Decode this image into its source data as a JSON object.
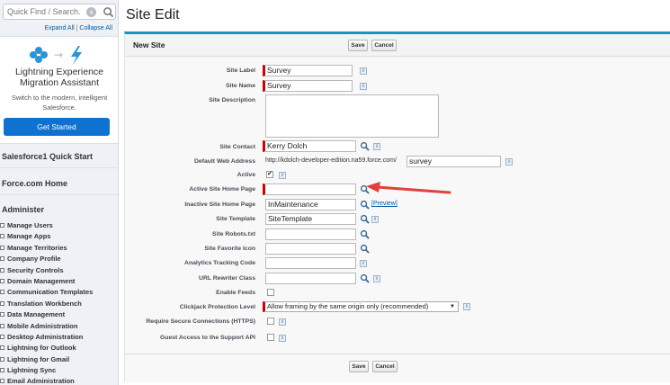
{
  "sidebar": {
    "search": {
      "placeholder": "Quick Find / Search...",
      "clear_label": "x"
    },
    "expand_all": "Expand All",
    "separator": "|",
    "collapse_all": "Collapse All",
    "lightning": {
      "title_line1": "Lightning Experience",
      "title_line2": "Migration Assistant",
      "desc_line1": "Switch to the modern, intelligent",
      "desc_line2": "Salesforce.",
      "button": "Get Started"
    },
    "sections": [
      "Salesforce1 Quick Start",
      "Force.com Home",
      "Administer"
    ],
    "admin_items": [
      "Manage Users",
      "Manage Apps",
      "Manage Territories",
      "Company Profile",
      "Security Controls",
      "Domain Management",
      "Communication Templates",
      "Translation Workbench",
      "Data Management",
      "Mobile Administration",
      "Desktop Administration",
      "Lightning for Outlook",
      "Lightning for Gmail",
      "Lightning Sync",
      "Email Administration"
    ]
  },
  "main": {
    "page_title": "Site Edit",
    "panel_title": "New Site",
    "save": "Save",
    "cancel": "Cancel",
    "info_glyph": "i",
    "fields": {
      "site_label": {
        "label": "Site Label",
        "value": "Survey"
      },
      "site_name": {
        "label": "Site Name",
        "value": "Survey"
      },
      "site_description": {
        "label": "Site Description",
        "value": ""
      },
      "site_contact": {
        "label": "Site Contact",
        "value": "Kerry Dolch"
      },
      "default_web_address": {
        "label": "Default Web Address",
        "prefix": "http://kdolch-developer-edition.na59.force.com/",
        "value": "survey"
      },
      "active": {
        "label": "Active",
        "checked": "✔"
      },
      "active_home_page": {
        "label": "Active Site Home Page",
        "value": ""
      },
      "inactive_home_page": {
        "label": "Inactive Site Home Page",
        "value": "InMaintenance",
        "preview": "[Preview]"
      },
      "site_template": {
        "label": "Site Template",
        "value": "SiteTemplate"
      },
      "site_robots": {
        "label": "Site Robots.txt",
        "value": ""
      },
      "site_favorite_icon": {
        "label": "Site Favorite Icon",
        "value": ""
      },
      "analytics_code": {
        "label": "Analytics Tracking Code",
        "value": ""
      },
      "url_rewriter": {
        "label": "URL Rewriter Class",
        "value": ""
      },
      "enable_feeds": {
        "label": "Enable Feeds"
      },
      "clickjack": {
        "label": "Clickjack Protection Level",
        "value": "Allow framing by the same origin only (recommended)"
      },
      "require_https": {
        "label": "Require Secure Connections (HTTPS)"
      },
      "guest_api": {
        "label": "Guest Access to the Support API"
      }
    }
  },
  "colors": {
    "accent": "#1797c0",
    "required": "#cc0000",
    "button_blue": "#0f72d0",
    "arrow": "#e0413a"
  }
}
